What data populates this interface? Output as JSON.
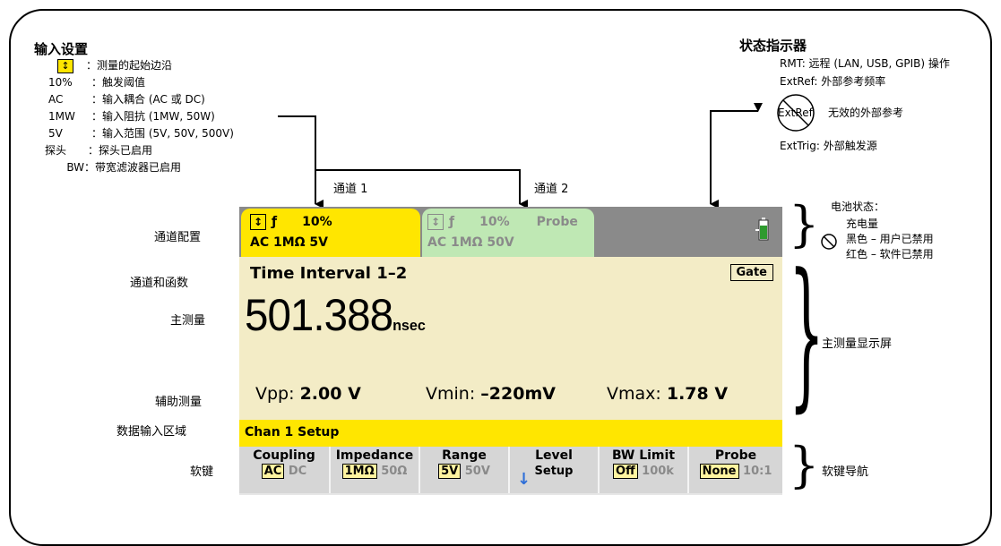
{
  "input_settings": {
    "title": "输入设置",
    "items": [
      {
        "key": "↕",
        "desc": "：测量的起始边沿"
      },
      {
        "key": "10%",
        "desc": "：触发阈值"
      },
      {
        "key": "AC",
        "desc": "：输入耦合 (AC 或 DC)"
      },
      {
        "key": "1MW",
        "desc": "：输入阻抗 (1MW, 50W)"
      },
      {
        "key": "5V",
        "desc": "：输入范围 (5V, 50V, 500V)"
      },
      {
        "key": "探头",
        "desc": "：探头已启用"
      },
      {
        "key": "BW",
        "desc": "：带宽滤波器已启用"
      }
    ]
  },
  "status_indicators": {
    "title": "状态指示器",
    "rmt": "RMT: 远程 (LAN, USB, GPIB) 操作",
    "extref": "ExtRef: 外部参考频率",
    "extref_crossed": "ExtRef",
    "extref_invalid": "无效的外部参考",
    "exttrig": "ExtTrig: 外部触发源"
  },
  "channels": {
    "ch1": "通道 1",
    "ch2": "通道 2"
  },
  "battery": {
    "title": "电池状态：",
    "line1": "充电量",
    "line2": "黑色 – 用户已禁用",
    "line3": "红色 – 软件已禁用"
  },
  "left_labels": {
    "channel_config": "通道配置",
    "channel_function": "通道和函数",
    "main_measurement": "主测量",
    "aux_measurement": "辅助测量",
    "data_entry": "数据输入区域",
    "softkeys": "软键"
  },
  "right_labels": {
    "main_display": "主测量显示屏",
    "softkey_nav": "软键导航"
  },
  "display": {
    "tab1": {
      "trig": "↕",
      "slope": "ƒ",
      "threshold": "10%",
      "line2": "AC 1MΩ  5V"
    },
    "tab2": {
      "trig": "↕",
      "slope": "ƒ",
      "threshold": "10%",
      "probe": "Probe",
      "line2": "AC 1MΩ  50V"
    },
    "function": "Time Interval 1–2",
    "gate": "Gate",
    "value": "501.388",
    "unit": "nsec",
    "aux": {
      "vpp_label": "Vpp:",
      "vpp": "2.00 V",
      "vmin_label": "Vmin:",
      "vmin": "–220mV",
      "vmax_label": "Vmax:",
      "vmax": "1.78 V"
    },
    "entry": "Chan 1 Setup",
    "softkeys": [
      {
        "title": "Coupling",
        "sel": "AC",
        "unsel": "DC"
      },
      {
        "title": "Impedance",
        "sel": "1MΩ",
        "unsel": "50Ω"
      },
      {
        "title": "Range",
        "sel": "5V",
        "unsel": "50V"
      },
      {
        "title": "Level",
        "sub": "Setup"
      },
      {
        "title": "BW Limit",
        "sel": "Off",
        "unsel": "100k"
      },
      {
        "title": "Probe",
        "sel": "None",
        "unsel": "10:1"
      }
    ]
  },
  "colors": {
    "yellow": "#ffe600",
    "green_tab": "#bfe8b4",
    "display_bg": "#f3ecc6",
    "gray": "#8a8a8a",
    "arrow_blue": "#2f6fd8"
  }
}
